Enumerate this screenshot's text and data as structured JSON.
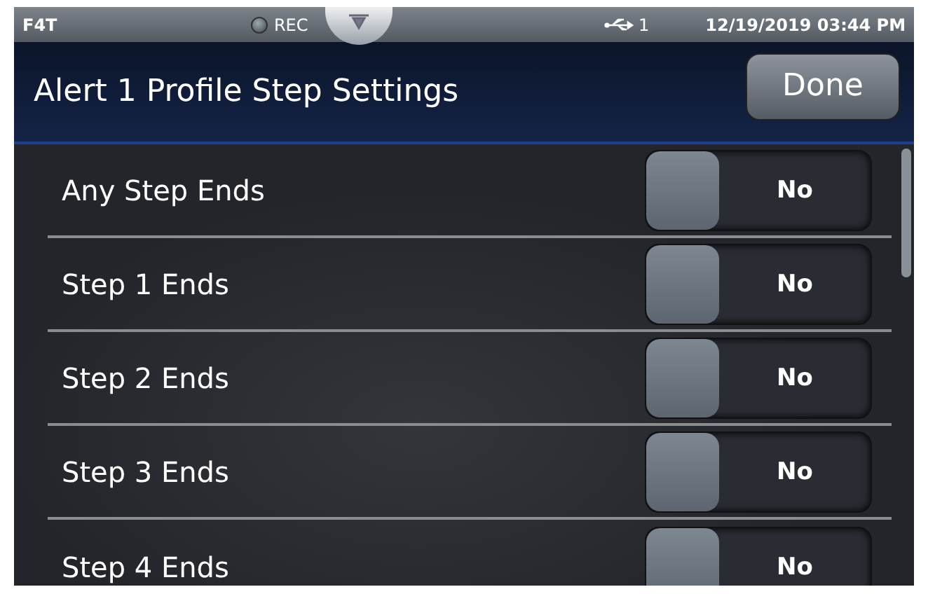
{
  "status_bar": {
    "model": "F4T",
    "recording": false,
    "rec_label": "REC",
    "usb_count": "1",
    "datetime": "12/19/2019 03:44 PM"
  },
  "header": {
    "title": "Alert 1 Profile Step Settings",
    "done_button": "Done"
  },
  "settings": [
    {
      "label": "Any Step Ends",
      "on": false,
      "value": "No"
    },
    {
      "label": "Step 1 Ends",
      "on": false,
      "value": "No"
    },
    {
      "label": "Step 2 Ends",
      "on": false,
      "value": "No"
    },
    {
      "label": "Step 3 Ends",
      "on": false,
      "value": "No"
    },
    {
      "label": "Step 4 Ends",
      "on": false,
      "value": "No"
    }
  ]
}
